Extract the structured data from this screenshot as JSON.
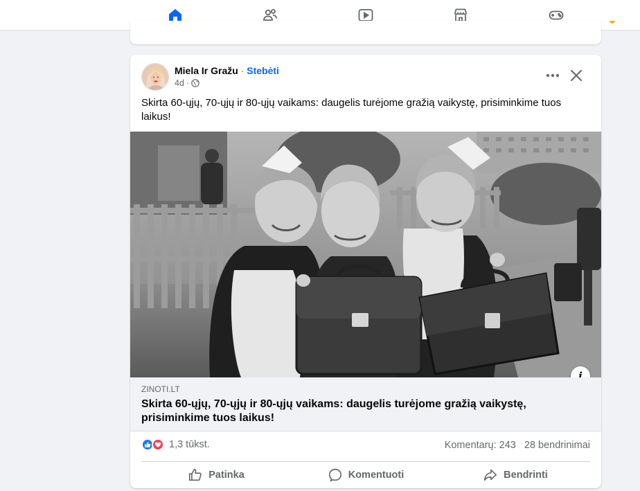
{
  "nav": {
    "tabs": [
      {
        "name": "home-icon",
        "active": true
      },
      {
        "name": "friends-icon",
        "active": false
      },
      {
        "name": "video-icon",
        "active": false
      },
      {
        "name": "marketplace-icon",
        "active": false
      },
      {
        "name": "gaming-icon",
        "active": false
      }
    ],
    "accent": "#0866ff"
  },
  "post": {
    "author": "Miela Ir Gražu",
    "separator": "·",
    "follow_label": "Stebėti",
    "time": "4d",
    "time_separator": "·",
    "privacy_icon": "globe-icon",
    "text": "Skirta 60-ųjų, 70-ųjų ir 80-ųjų vaikams: daugelis turėjome gražią vaikystę, prisiminkime tuos laikus!",
    "link": {
      "domain": "ZINOTI.LT",
      "title": "Skirta 60-ųjų, 70-ųjų ir 80-ųjų vaikams: daugelis turėjome gražią vaikystę, prisiminkime tuos laikus!"
    },
    "info_label": "i",
    "reactions": {
      "types": [
        "like",
        "love"
      ],
      "count": "1,3 tūkst."
    },
    "comments": "Komentarų: 243",
    "shares": "28 bendrinimai",
    "actions": {
      "like": "Patinka",
      "comment": "Komentuoti",
      "share": "Bendrinti"
    }
  }
}
